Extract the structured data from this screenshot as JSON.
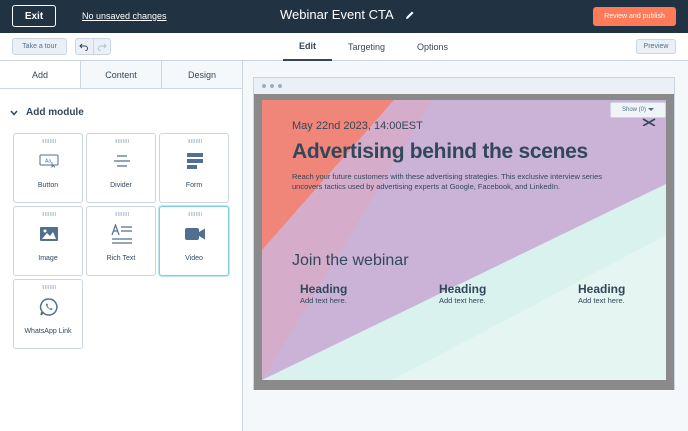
{
  "header": {
    "exit_label": "Exit",
    "unsaved_label": "No unsaved changes",
    "title": "Webinar Event CTA",
    "publish_label": "Review and publish"
  },
  "toolbar": {
    "tour_label": "Take a tour",
    "tabs": [
      {
        "label": "Edit",
        "active": true
      },
      {
        "label": "Targeting",
        "active": false
      },
      {
        "label": "Options",
        "active": false
      }
    ],
    "preview_label": "Preview"
  },
  "panel": {
    "tabs": [
      {
        "label": "Add",
        "active": true
      },
      {
        "label": "Content",
        "active": false
      },
      {
        "label": "Design",
        "active": false
      }
    ],
    "section_title": "Add module",
    "modules": [
      {
        "label": "Button",
        "icon": "button-icon"
      },
      {
        "label": "Divider",
        "icon": "divider-icon"
      },
      {
        "label": "Form",
        "icon": "form-icon"
      },
      {
        "label": "Image",
        "icon": "image-icon"
      },
      {
        "label": "Rich Text",
        "icon": "rich-text-icon"
      },
      {
        "label": "Video",
        "icon": "video-icon"
      },
      {
        "label": "WhatsApp Link",
        "icon": "whatsapp-icon"
      }
    ]
  },
  "preview": {
    "show_label": "Show (0)",
    "date": "May 22nd 2023, 14:00EST",
    "headline": "Advertising behind the scenes",
    "description": "Reach your future customers with these advertising strategies. This exclusive interview series uncovers tactics used by advertising experts at Google, Facebook, and LinkedIn.",
    "join_label": "Join the webinar",
    "columns": [
      {
        "heading": "Heading",
        "text": "Add text here."
      },
      {
        "heading": "Heading",
        "text": "Add text here."
      },
      {
        "heading": "Heading",
        "text": "Add text here."
      }
    ]
  },
  "colors": {
    "topbar": "#213343",
    "accent": "#ff7a59",
    "coral": "#f0857a",
    "lavender": "#cbb3d8",
    "mint": "#d9f2ee"
  }
}
